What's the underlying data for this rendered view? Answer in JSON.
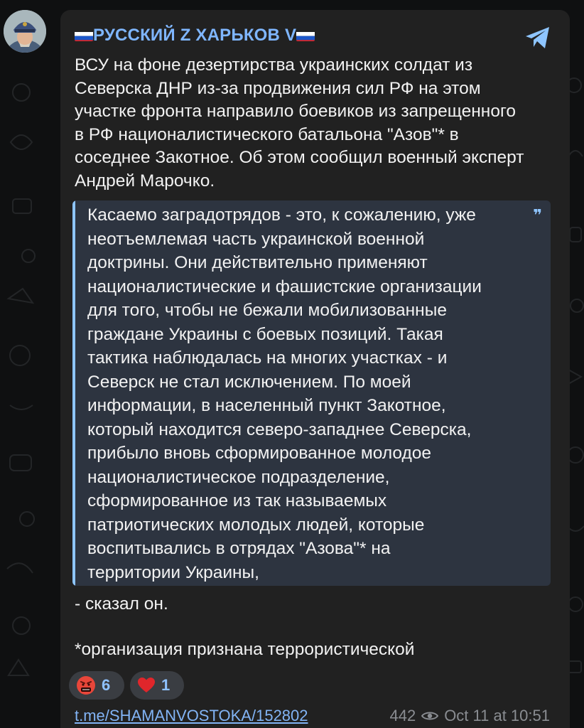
{
  "channel": {
    "flag_left": "🇷🇺",
    "name": "РУССКИЙ Z ХАРЬКОВ V",
    "flag_right": "🇷🇺"
  },
  "post": {
    "lines": [
      "ВСУ на фоне дезертирства украинских солдат из",
      "Северска ДНР из-за продвижения сил РФ на этом",
      "участке фронта направило боевиков из запрещенного",
      "в РФ националистического батальона \"Азов\"* в",
      "соседнее Закотное. Об этом сообщил военный эксперт",
      "Андрей Марочко."
    ],
    "quote_mark": "❞",
    "quote_lines": [
      "Касаемо заградотрядов - это, к сожалению, уже",
      "неотъемлемая часть украинской военной",
      "доктрины. Они действительно применяют",
      "националистические и фашистские организации",
      "для того, чтобы не бежали мобилизованные",
      "граждане Украины с боевых позиций. Такая",
      "тактика наблюдалась на многих участках - и",
      "Северск не стал исключением. По моей",
      "информации, в населенный пункт Закотное,",
      "который находится северо-западнее Северска,",
      "прибыло вновь сформированное молодое",
      "националистическое подразделение,",
      "сформированное из так называемых",
      "патриотических молодых людей, которые",
      "воспитывались в отрядах \"Азова\"* на",
      "территории Украины,"
    ],
    "after_quote": "- сказал он.",
    "footnote": "*организация признана террористической"
  },
  "reactions": [
    {
      "emoji_name": "angry-cursing-face-icon",
      "count": "6"
    },
    {
      "emoji_name": "red-heart-icon",
      "emoji": "❤️",
      "count": "1"
    }
  ],
  "footer": {
    "link": "t.me/SHAMANVOSTOKA/152802",
    "views": "442",
    "timestamp": "Oct 11 at 10:51"
  },
  "colors": {
    "accent": "#7fb6ff",
    "quote_bg": "#2d3440",
    "bubble_bg": "#212121"
  }
}
